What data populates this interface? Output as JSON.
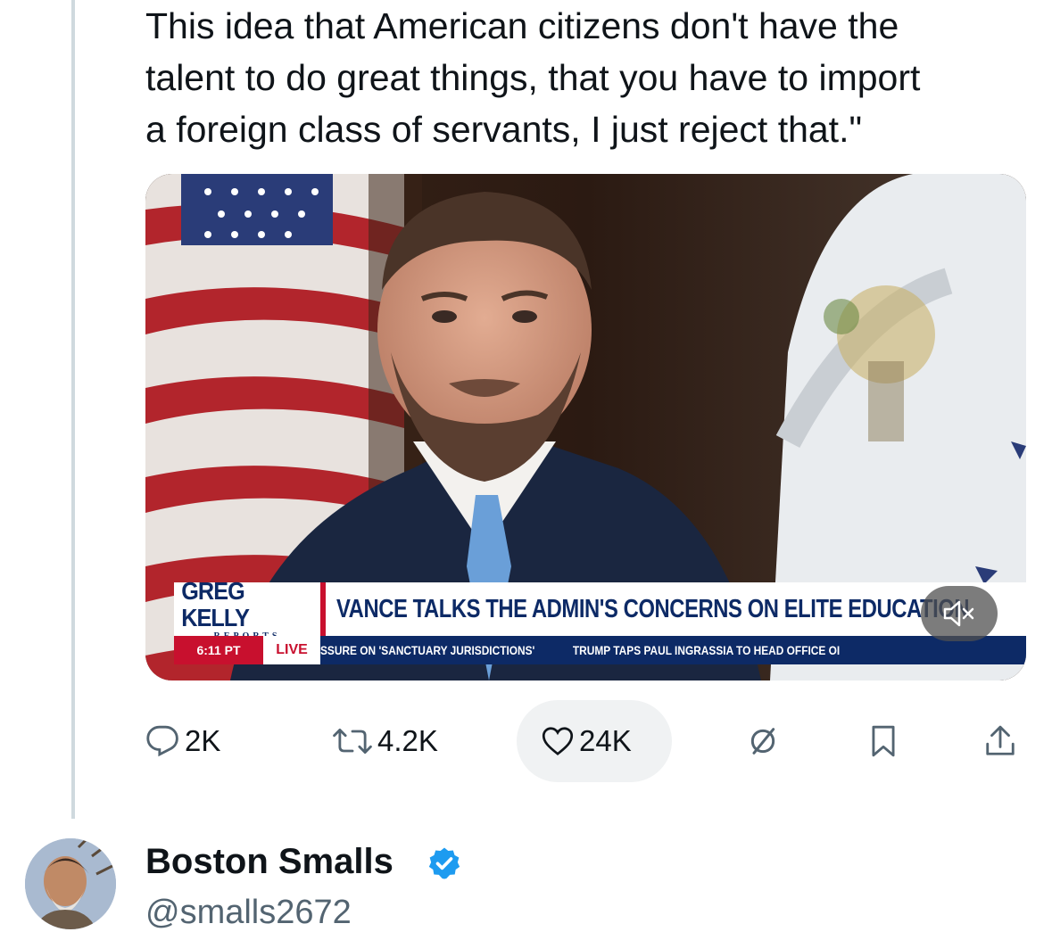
{
  "tweet": {
    "text": "This idea that American citizens don't have the\ntalent to do great things, that you have to import\na foreign class of servants, I just reject that.\""
  },
  "video": {
    "brand_name": "GREG KELLY",
    "brand_sub": "REPORTS",
    "headline": "VANCE TALKS THE ADMIN'S CONCERNS ON ELITE EDUCATION",
    "time": "6:11 PT",
    "live": "LIVE",
    "ticker_items": [
      "SSURE ON 'SANCTUARY JURISDICTIONS'",
      "TRUMP TAPS PAUL INGRASSIA TO HEAD OFFICE OI"
    ],
    "mute_icon": "speaker-muted-icon"
  },
  "actions": {
    "replies": "2K",
    "reposts": "4.2K",
    "likes": "24K",
    "icons": [
      "reply-icon",
      "repost-icon",
      "like-icon",
      "views-icon",
      "bookmark-icon",
      "share-icon"
    ]
  },
  "next_author": {
    "name": "Boston Smalls",
    "handle": "@smalls2672",
    "verified_color": "#1d9bf0"
  },
  "colors": {
    "accent": "#1d9bf0",
    "text": "#0f1419",
    "muted": "#536471",
    "like_pill": "#f0f2f3",
    "news_red": "#c8102e",
    "news_blue": "#0d2a66"
  }
}
